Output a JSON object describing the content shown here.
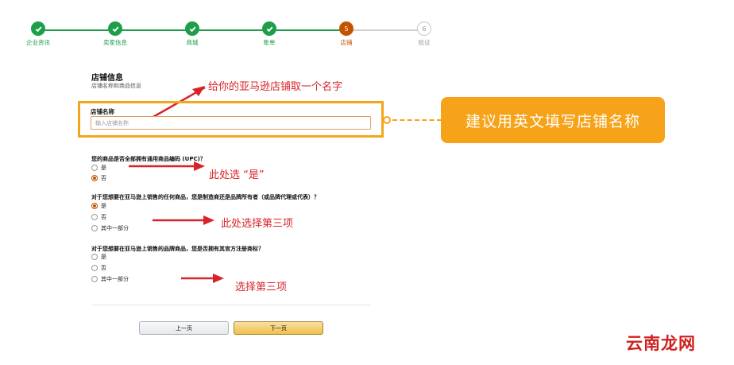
{
  "stepper": {
    "steps": [
      {
        "label": "企业资讯",
        "status": "done",
        "num": ""
      },
      {
        "label": "卖家信息",
        "status": "done",
        "num": ""
      },
      {
        "label": "商城",
        "status": "done",
        "num": ""
      },
      {
        "label": "账单",
        "status": "done",
        "num": ""
      },
      {
        "label": "店铺",
        "status": "current",
        "num": "5"
      },
      {
        "label": "验证",
        "status": "todo",
        "num": "6"
      }
    ]
  },
  "section": {
    "title": "店铺信息",
    "subtitle": "店铺名称和商品信息"
  },
  "store_name": {
    "label": "店铺名称",
    "placeholder": "输入店铺名称"
  },
  "callout": {
    "text": "建议用英文填写店铺名称"
  },
  "questions": [
    {
      "text": "您的商品是否全部拥有通用商品编码 (UPC)？",
      "options": [
        {
          "label": "是",
          "selected": false
        },
        {
          "label": "否",
          "selected": true
        }
      ]
    },
    {
      "text": "对于您想要在亚马逊上销售的任何商品，您是制造商还是品牌所有者（或品牌代理或代表）？",
      "options": [
        {
          "label": "是",
          "selected": true
        },
        {
          "label": "否",
          "selected": false
        },
        {
          "label": "其中一部分",
          "selected": false
        }
      ]
    },
    {
      "text": "对于您想要在亚马逊上销售的品牌商品，您是否拥有其官方注册商标？",
      "options": [
        {
          "label": "是",
          "selected": false
        },
        {
          "label": "否",
          "selected": false
        },
        {
          "label": "其中一部分",
          "selected": false
        }
      ]
    }
  ],
  "annotations": {
    "name_hint": "给你的亚马逊店铺取一个名字",
    "q1_hint": "此处选 “是”",
    "q2_hint": "此处选择第三项",
    "q3_hint": "选择第三项"
  },
  "buttons": {
    "prev": "上一页",
    "next": "下一页"
  },
  "watermark": "云南龙网",
  "colors": {
    "done": "#1e9e4a",
    "current": "#c45500",
    "callout": "#f6a319",
    "annotation": "#d8232a"
  }
}
